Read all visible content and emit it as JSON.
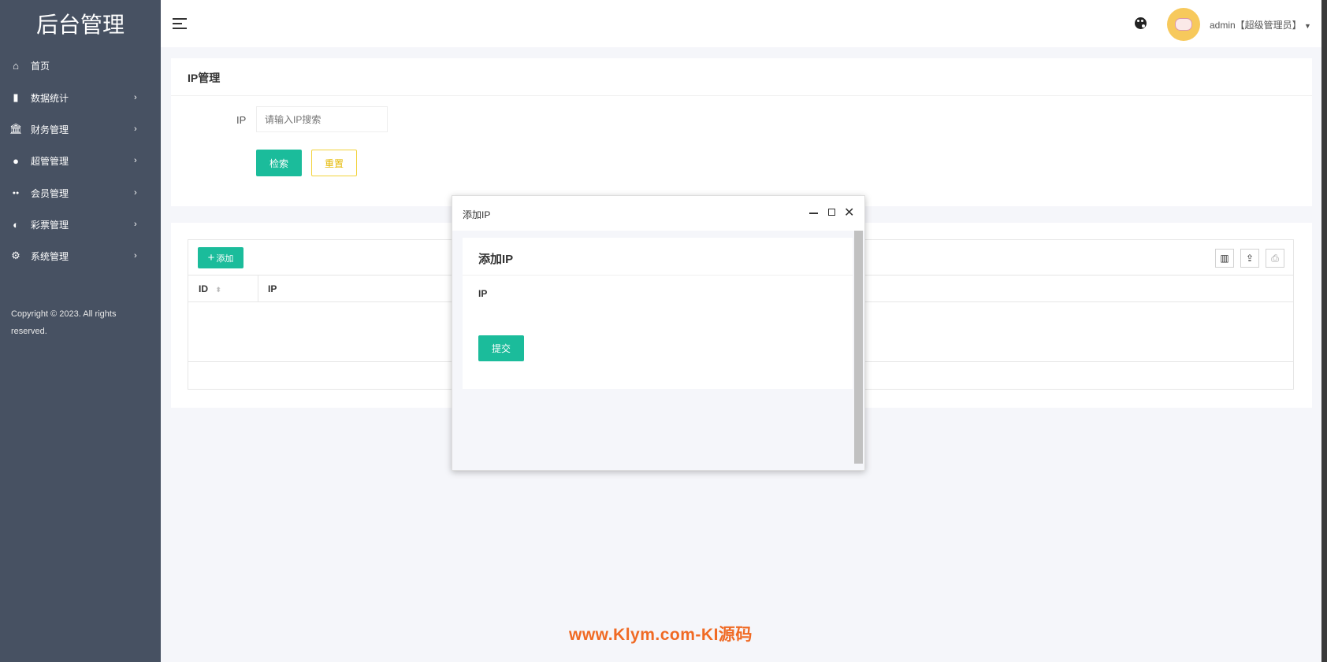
{
  "sidebar": {
    "title": "后台管理",
    "items": [
      {
        "label": "首页",
        "icon": "home-icon",
        "arrow": false
      },
      {
        "label": "数据统计",
        "icon": "bar-chart-icon",
        "arrow": true
      },
      {
        "label": "财务管理",
        "icon": "bank-icon",
        "arrow": true
      },
      {
        "label": "超管管理",
        "icon": "user-icon",
        "arrow": true
      },
      {
        "label": "会员管理",
        "icon": "users-icon",
        "arrow": true
      },
      {
        "label": "彩票管理",
        "icon": "gamepad-icon",
        "arrow": true
      },
      {
        "label": "系统管理",
        "icon": "gear-icon",
        "arrow": true
      }
    ],
    "copyright": "Copyright © 2023. All rights reserved."
  },
  "header": {
    "user": "admin【超级管理员】"
  },
  "search": {
    "title": "IP管理",
    "ip_label": "IP",
    "ip_placeholder": "请输入IP搜索",
    "search_btn": "检索",
    "reset_btn": "重置"
  },
  "table": {
    "add_btn": "添加",
    "columns": [
      "ID",
      "IP"
    ]
  },
  "modal": {
    "title": "添加IP",
    "heading": "添加IP",
    "ip_label": "IP",
    "submit": "提交"
  },
  "watermark": "www.Klym.com-KI源码",
  "colors": {
    "sidebar": "#475162",
    "primary": "#1bbc9b",
    "warning": "#f2d23b",
    "watermark": "#f06a24"
  }
}
